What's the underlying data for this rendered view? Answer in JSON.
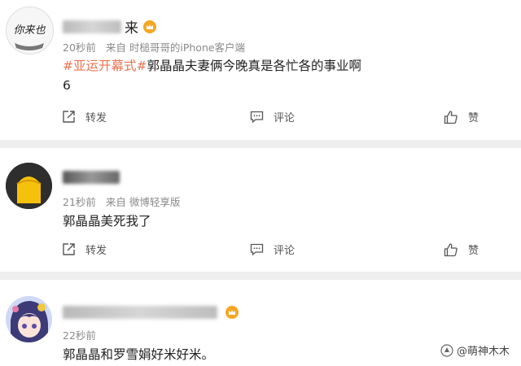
{
  "comments": [
    {
      "username_visible": "来",
      "time": "20秒前",
      "source": "来自 时槌哥哥的iPhone客户端",
      "tag": "#亚运开幕式#",
      "content": "郭晶晶夫妻俩今晚真是各忙各的事业啊",
      "content_line2": "6",
      "avatar_text": "你来也"
    },
    {
      "time": "21秒前",
      "source": "来自 微博轻享版",
      "content": "郭晶晶美死我了"
    },
    {
      "time": "22秒前",
      "content": "郭晶晶和罗雪娟好米好米。"
    }
  ],
  "actions": {
    "repost_label": "转发",
    "comment_label": "评论",
    "like_label": "赞"
  },
  "watermark": "@萌神木木",
  "colors": {
    "tag": "#eb7350",
    "meta": "#8a8a8a",
    "background": "#eeeeee"
  }
}
